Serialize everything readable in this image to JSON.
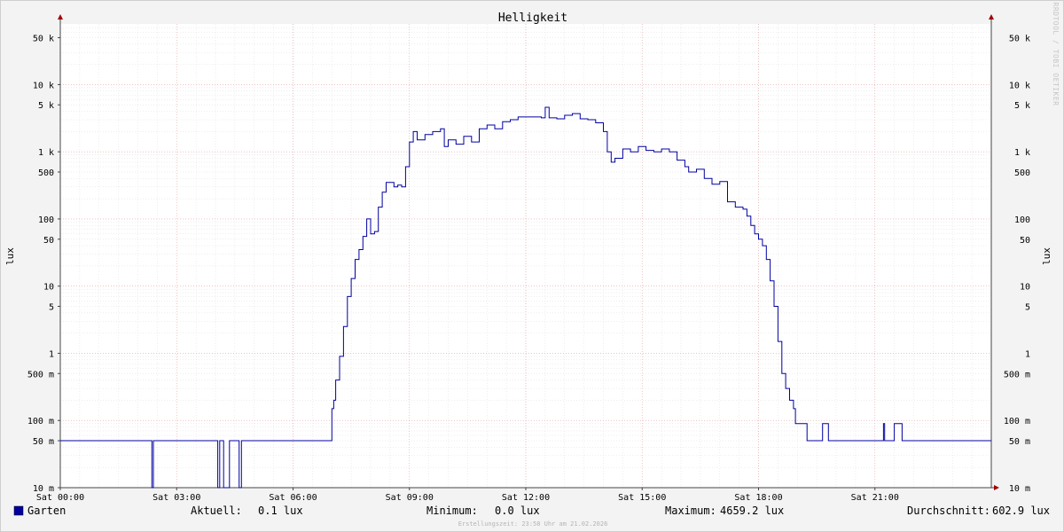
{
  "chart_data": {
    "type": "line",
    "title": "Helligkeit",
    "ylabel": "lux",
    "y_scale": "log",
    "ylim": [
      0.01,
      80000
    ],
    "xlim": [
      0,
      24
    ],
    "x_tick_labels": [
      "Sat 00:00",
      "Sat 03:00",
      "Sat 06:00",
      "Sat 09:00",
      "Sat 12:00",
      "Sat 15:00",
      "Sat 18:00",
      "Sat 21:00"
    ],
    "x_tick_values": [
      0,
      3,
      6,
      9,
      12,
      15,
      18,
      21
    ],
    "y_tick_values": [
      0.01,
      0.05,
      0.1,
      0.5,
      1,
      5,
      10,
      50,
      100,
      500,
      1000,
      5000,
      10000,
      50000
    ],
    "y_tick_labels": [
      "10 m",
      "50 m",
      "100 m",
      "500 m",
      "1",
      "5",
      "10",
      "50",
      "100",
      "500",
      "1 k",
      "5 k",
      "10 k",
      "50 k"
    ],
    "grid": true,
    "series": [
      {
        "name": "Garten",
        "color": "#0000a0",
        "points": [
          [
            0.0,
            0.05
          ],
          [
            2.35,
            0.05
          ],
          [
            2.36,
            0.01
          ],
          [
            2.4,
            0.05
          ],
          [
            4.05,
            0.05
          ],
          [
            4.06,
            0.01
          ],
          [
            4.1,
            0.01
          ],
          [
            4.11,
            0.05
          ],
          [
            4.2,
            0.05
          ],
          [
            4.21,
            0.01
          ],
          [
            4.35,
            0.01
          ],
          [
            4.36,
            0.05
          ],
          [
            4.6,
            0.05
          ],
          [
            4.61,
            0.01
          ],
          [
            4.66,
            0.01
          ],
          [
            4.67,
            0.05
          ],
          [
            6.95,
            0.05
          ],
          [
            7.0,
            0.15
          ],
          [
            7.05,
            0.2
          ],
          [
            7.1,
            0.4
          ],
          [
            7.2,
            0.9
          ],
          [
            7.3,
            2.5
          ],
          [
            7.4,
            7
          ],
          [
            7.5,
            13
          ],
          [
            7.6,
            25
          ],
          [
            7.7,
            35
          ],
          [
            7.8,
            55
          ],
          [
            7.9,
            100
          ],
          [
            8.0,
            60
          ],
          [
            8.1,
            65
          ],
          [
            8.2,
            150
          ],
          [
            8.3,
            250
          ],
          [
            8.4,
            350
          ],
          [
            8.5,
            350
          ],
          [
            8.6,
            300
          ],
          [
            8.7,
            320
          ],
          [
            8.8,
            300
          ],
          [
            8.9,
            600
          ],
          [
            9.0,
            1400
          ],
          [
            9.1,
            2000
          ],
          [
            9.2,
            1500
          ],
          [
            9.4,
            1800
          ],
          [
            9.6,
            2000
          ],
          [
            9.8,
            2200
          ],
          [
            9.9,
            1200
          ],
          [
            10.0,
            1500
          ],
          [
            10.2,
            1300
          ],
          [
            10.4,
            1700
          ],
          [
            10.6,
            1400
          ],
          [
            10.8,
            2200
          ],
          [
            11.0,
            2500
          ],
          [
            11.2,
            2200
          ],
          [
            11.4,
            2800
          ],
          [
            11.6,
            3000
          ],
          [
            11.8,
            3300
          ],
          [
            12.0,
            3300
          ],
          [
            12.2,
            3300
          ],
          [
            12.4,
            3200
          ],
          [
            12.5,
            4600
          ],
          [
            12.6,
            3200
          ],
          [
            12.8,
            3100
          ],
          [
            13.0,
            3500
          ],
          [
            13.2,
            3700
          ],
          [
            13.4,
            3100
          ],
          [
            13.6,
            3000
          ],
          [
            13.8,
            2700
          ],
          [
            14.0,
            2000
          ],
          [
            14.1,
            1000
          ],
          [
            14.2,
            700
          ],
          [
            14.3,
            800
          ],
          [
            14.5,
            1100
          ],
          [
            14.7,
            1000
          ],
          [
            14.9,
            1200
          ],
          [
            15.1,
            1050
          ],
          [
            15.3,
            1000
          ],
          [
            15.5,
            1100
          ],
          [
            15.7,
            1000
          ],
          [
            15.9,
            750
          ],
          [
            16.1,
            600
          ],
          [
            16.2,
            500
          ],
          [
            16.4,
            550
          ],
          [
            16.6,
            400
          ],
          [
            16.8,
            330
          ],
          [
            17.0,
            360
          ],
          [
            17.2,
            180
          ],
          [
            17.4,
            150
          ],
          [
            17.6,
            140
          ],
          [
            17.7,
            110
          ],
          [
            17.8,
            80
          ],
          [
            17.9,
            60
          ],
          [
            18.0,
            50
          ],
          [
            18.1,
            40
          ],
          [
            18.2,
            25
          ],
          [
            18.3,
            12
          ],
          [
            18.4,
            5
          ],
          [
            18.5,
            1.5
          ],
          [
            18.6,
            0.5
          ],
          [
            18.7,
            0.3
          ],
          [
            18.8,
            0.2
          ],
          [
            18.9,
            0.15
          ],
          [
            18.95,
            0.09
          ],
          [
            19.2,
            0.09
          ],
          [
            19.25,
            0.05
          ],
          [
            19.6,
            0.05
          ],
          [
            19.65,
            0.09
          ],
          [
            19.75,
            0.09
          ],
          [
            19.8,
            0.05
          ],
          [
            21.2,
            0.05
          ],
          [
            21.22,
            0.09
          ],
          [
            21.25,
            0.05
          ],
          [
            21.45,
            0.05
          ],
          [
            21.5,
            0.09
          ],
          [
            21.65,
            0.09
          ],
          [
            21.7,
            0.05
          ],
          [
            24.0,
            0.05
          ]
        ]
      }
    ]
  },
  "legend": {
    "series_name": "Garten",
    "swatch_color": "#0000a0",
    "aktuell_label": "Aktuell:",
    "aktuell_value": "0.1 lux",
    "minimum_label": "Minimum:",
    "minimum_value": "0.0 lux",
    "maximum_label": "Maximum:",
    "maximum_value": "4659.2 lux",
    "durchschnitt_label": "Durchschnitt:",
    "durchschnitt_value": "602.9 lux"
  },
  "watermark": "RRDTOOL / TOBI OETIKER",
  "footer": "Erstellungszeit: 23:58 Uhr am 21.02.2026"
}
